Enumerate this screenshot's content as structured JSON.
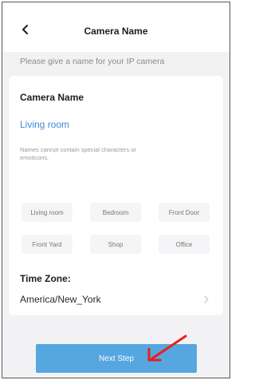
{
  "header": {
    "title": "Camera Name"
  },
  "subtitle": "Please give a name for your IP camera",
  "camera_name": {
    "section_title": "Camera Name",
    "value": "Living room",
    "hint": "Names cannot contain special characters or emoticons."
  },
  "presets": [
    "Living room",
    "Bedroom",
    "Front Door",
    "Front Yard",
    "Shop",
    "Office"
  ],
  "time_zone": {
    "label": "Time Zone:",
    "value": "America/New_York"
  },
  "next_button": {
    "label": "Next Step"
  },
  "colors": {
    "accent": "#56a6df",
    "link": "#3a8ad8",
    "annotation": "#e8201c",
    "background": "#f2f2f4"
  },
  "icons": {
    "back": "chevron-left-icon",
    "row_arrow": "chevron-right-icon",
    "annotation": "red-arrow"
  }
}
